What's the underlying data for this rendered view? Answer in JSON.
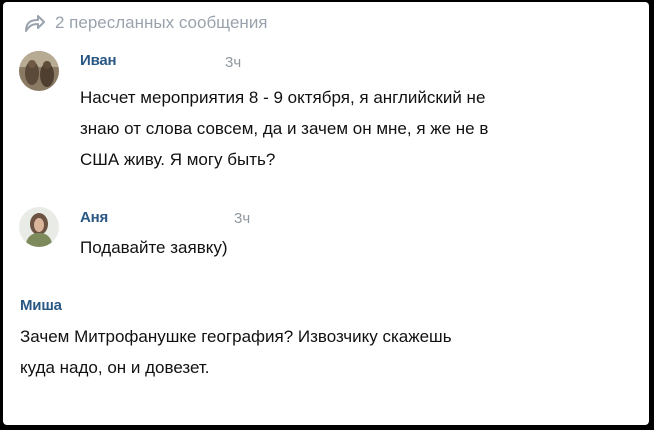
{
  "forward_header": {
    "icon": "forward-arrow-icon",
    "text": "2 пересланных сообщения"
  },
  "messages": [
    {
      "author": "Иван",
      "time": "3ч",
      "avatar": "avatar-photo-ivan",
      "lines": [
        "Насчет мероприятия 8 - 9 октября, я английский не",
        "знаю от слова совсем, да и зачем он мне, я же не в",
        "США живу. Я могу быть?"
      ]
    },
    {
      "author": "Аня",
      "time": "3ч",
      "avatar": "avatar-photo-anya",
      "lines": [
        "Подавайте заявку)"
      ]
    }
  ],
  "reply": {
    "author": "Миша",
    "lines": [
      "Зачем Митрофанушке география? Извозчику скажешь",
      "куда надо, он и довезет."
    ]
  },
  "colors": {
    "author": "#2a5885",
    "muted": "#9aa3ad",
    "text": "#111111",
    "frame": "#000000"
  }
}
